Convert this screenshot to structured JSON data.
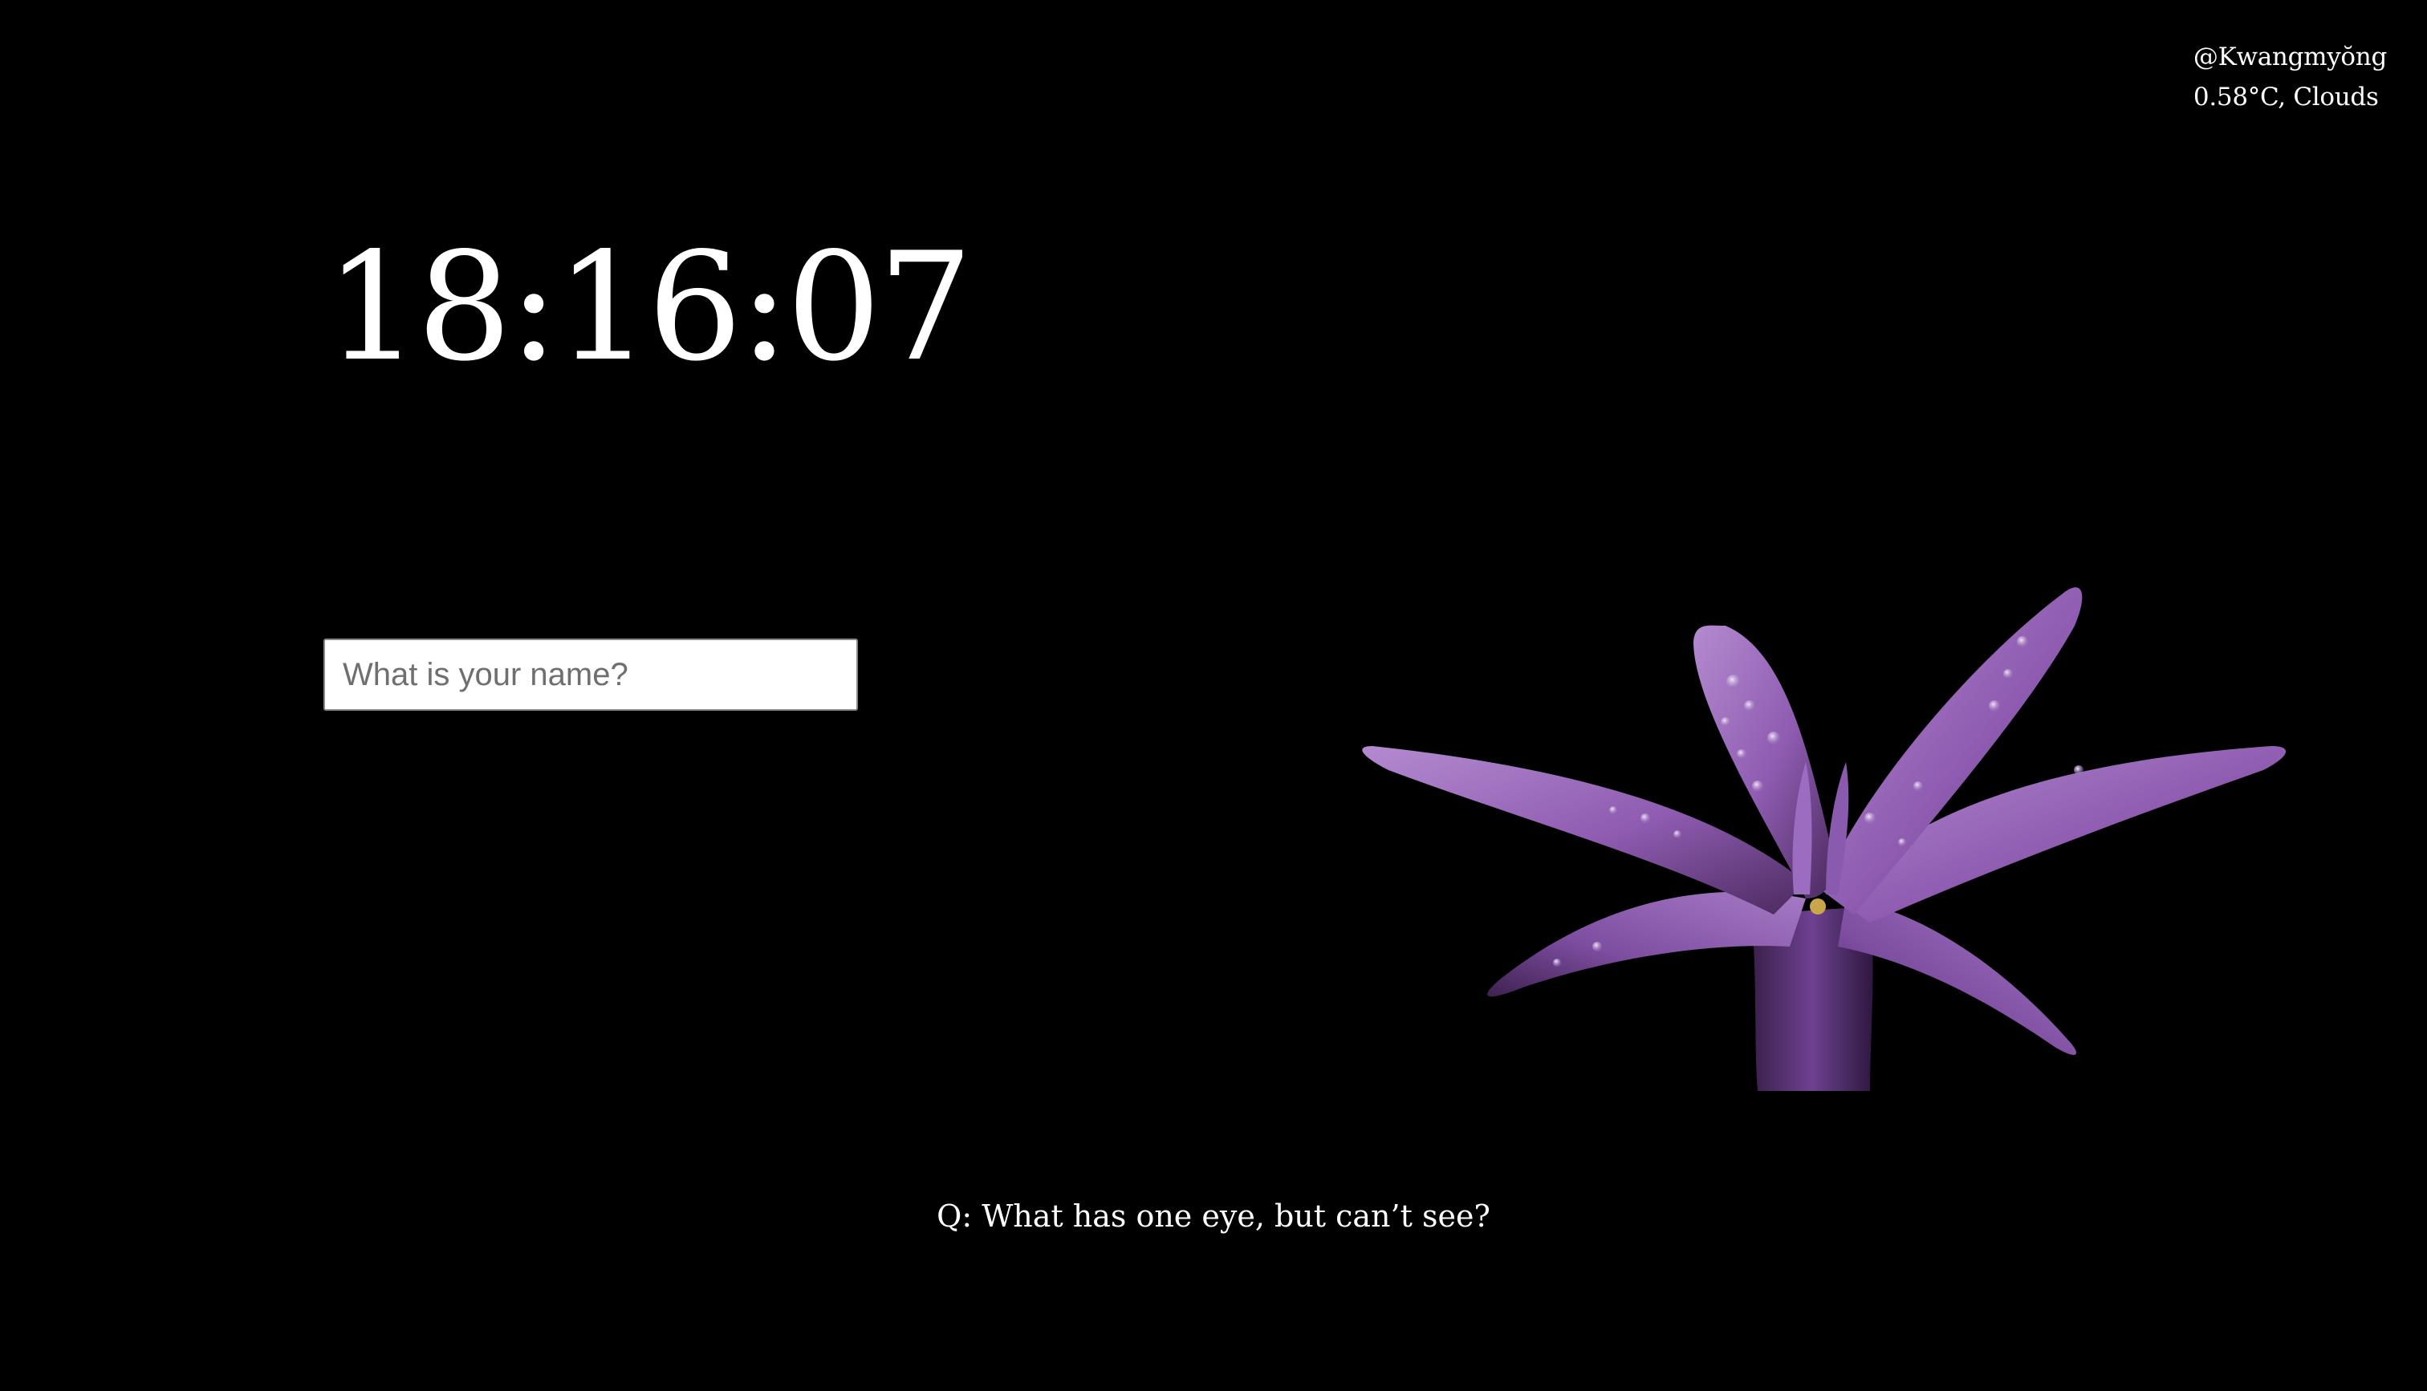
{
  "header": {
    "location": "@Kwangmyŏng",
    "weather": "0.58°C, Clouds"
  },
  "clock": {
    "time": "18:16:07"
  },
  "name_prompt": {
    "placeholder": "What is your name?",
    "value": ""
  },
  "background_image": {
    "subject": "purple-flower-with-water-droplets",
    "petal_color": "#8e5bb0",
    "petal_highlight": "#b48ad0",
    "petal_shadow": "#4a2a5e"
  },
  "riddle": {
    "question": "Q: What has one eye, but can’t see?"
  },
  "colors": {
    "background": "#000000",
    "text": "#ffffff"
  }
}
